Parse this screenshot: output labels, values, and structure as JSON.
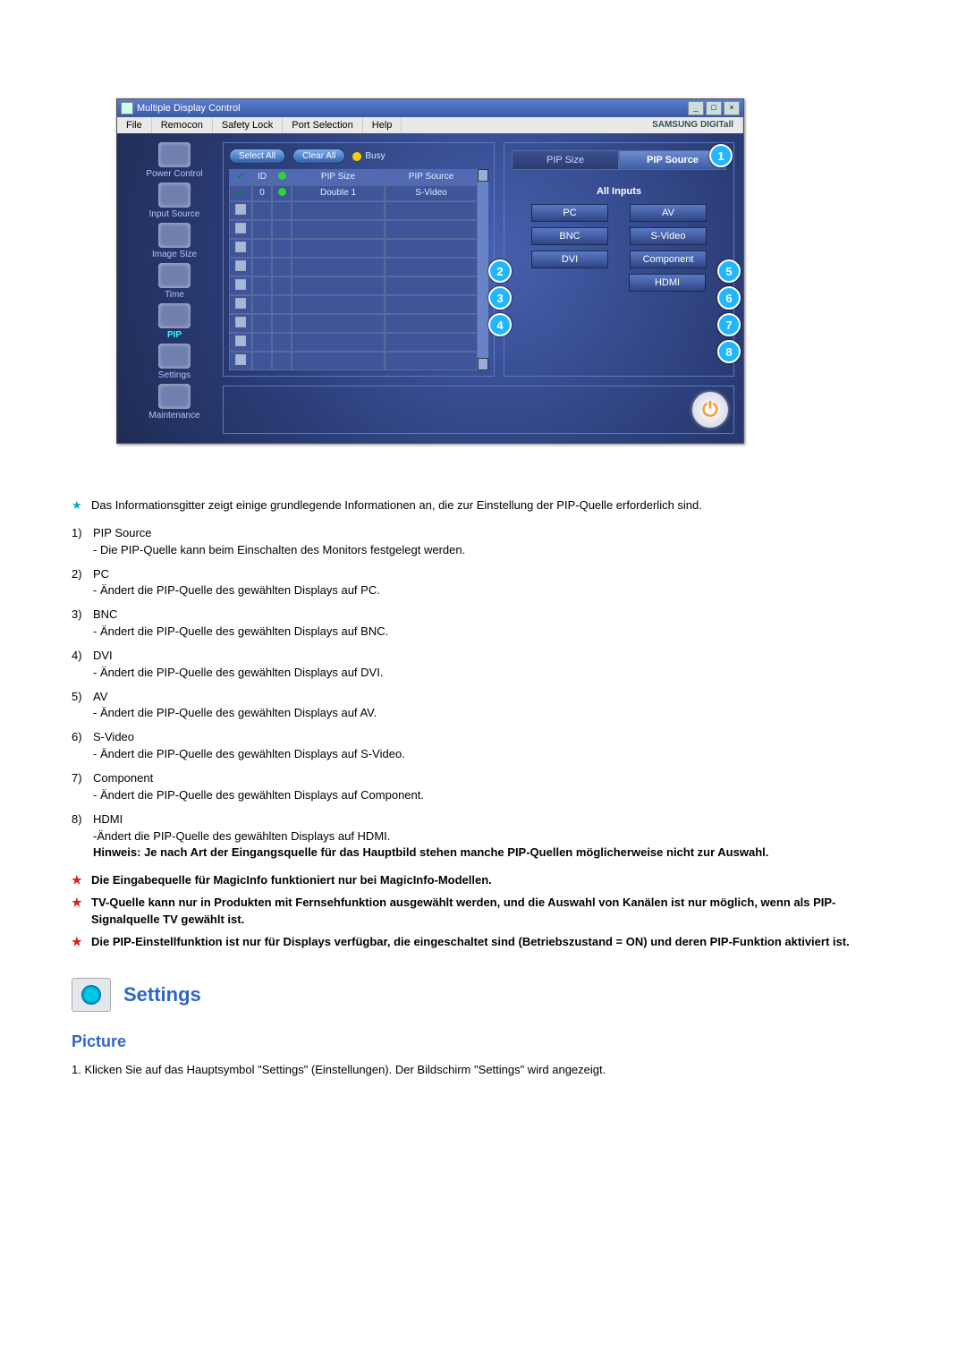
{
  "window": {
    "title": "Multiple Display Control",
    "menu": [
      "File",
      "Remocon",
      "Safety Lock",
      "Port Selection",
      "Help"
    ],
    "brand": "SAMSUNG DIGITall"
  },
  "sidebar": {
    "items": [
      {
        "label": "Power Control"
      },
      {
        "label": "Input Source"
      },
      {
        "label": "Image Size"
      },
      {
        "label": "Time"
      },
      {
        "label": "PIP"
      },
      {
        "label": "Settings"
      },
      {
        "label": "Maintenance"
      }
    ]
  },
  "toolbar": {
    "select_all": "Select All",
    "clear_all": "Clear All",
    "busy": "Busy"
  },
  "table": {
    "headers": {
      "id": "ID",
      "pip_size": "PIP Size",
      "pip_source": "PIP Source"
    },
    "rows": [
      {
        "id": "0",
        "pip_size": "Double 1",
        "pip_source": "S-Video"
      }
    ]
  },
  "right": {
    "tab_pipsize": "PIP Size",
    "tab_pipsource": "PIP Source",
    "all_inputs": "All Inputs",
    "buttons": {
      "pc": "PC",
      "bnc": "BNC",
      "dvi": "DVI",
      "av": "AV",
      "svideo": "S-Video",
      "component": "Component",
      "hdmi": "HDMI"
    },
    "callouts": {
      "c1": "1",
      "c2": "2",
      "c3": "3",
      "c4": "4",
      "c5": "5",
      "c6": "6",
      "c7": "7",
      "c8": "8"
    }
  },
  "doc": {
    "intro": "Das Informationsgitter zeigt einige grundlegende Informationen an, die zur Einstellung der PIP-Quelle erforderlich sind.",
    "items": [
      {
        "num": "1)",
        "title": "PIP Source",
        "desc": "- Die PIP-Quelle kann beim Einschalten des Monitors festgelegt werden."
      },
      {
        "num": "2)",
        "title": "PC",
        "desc": "- Ändert die PIP-Quelle des gewählten Displays auf PC."
      },
      {
        "num": "3)",
        "title": "BNC",
        "desc": "- Ändert die PIP-Quelle des gewählten Displays auf BNC."
      },
      {
        "num": "4)",
        "title": "DVI",
        "desc": "- Ändert die PIP-Quelle des gewählten Displays auf DVI."
      },
      {
        "num": "5)",
        "title": "AV",
        "desc": "- Ändert die PIP-Quelle des gewählten Displays auf AV."
      },
      {
        "num": "6)",
        "title": "S-Video",
        "desc": "- Ändert die PIP-Quelle des gewählten Displays auf S-Video."
      },
      {
        "num": "7)",
        "title": "Component",
        "desc": "- Ändert die PIP-Quelle des gewählten Displays auf Component."
      },
      {
        "num": "8)",
        "title": "HDMI",
        "desc": "-Ändert die PIP-Quelle des gewählten Displays auf HDMI."
      }
    ],
    "hint": "Hinweis: Je nach Art der Eingangsquelle für das Hauptbild stehen manche PIP-Quellen möglicherweise nicht zur Auswahl.",
    "notes": [
      "Die Eingabequelle für MagicInfo funktioniert nur bei MagicInfo-Modellen.",
      "TV-Quelle kann nur in Produkten mit Fernsehfunktion ausgewählt werden, und die Auswahl von Kanälen ist nur möglich, wenn als PIP-Signalquelle TV gewählt ist.",
      "Die PIP-Einstellfunktion ist nur für Displays verfügbar, die eingeschaltet sind (Betriebszustand = ON) und deren PIP-Funktion aktiviert ist."
    ],
    "settings_head": "Settings",
    "picture_head": "Picture",
    "picture_step": "1.  Klicken Sie auf das Hauptsymbol \"Settings\" (Einstellungen). Der Bildschirm \"Settings\" wird angezeigt."
  }
}
